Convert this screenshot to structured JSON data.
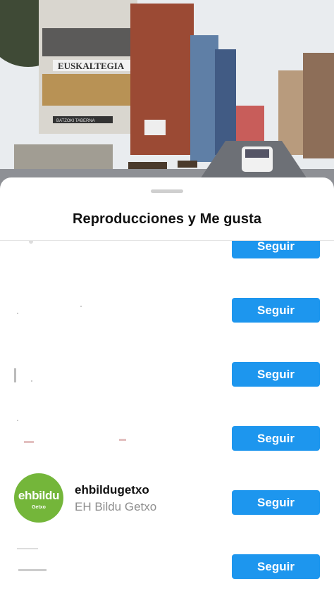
{
  "sheet": {
    "title": "Reproducciones y Me gusta"
  },
  "background": {
    "signs": [
      "EUSKALTEGIA",
      "BATZOKI TABERNA"
    ]
  },
  "list": {
    "items": [
      {
        "button_label": "Seguir",
        "username": "",
        "full_name": ""
      },
      {
        "button_label": "Seguir",
        "username": "",
        "full_name": ""
      },
      {
        "button_label": "Seguir",
        "username": "",
        "full_name": ""
      },
      {
        "button_label": "Seguir",
        "username": "",
        "full_name": ""
      },
      {
        "button_label": "Seguir",
        "username": "ehbildugetxo",
        "full_name": "EH Bildu Getxo",
        "avatar": {
          "logo_text": "ehbildu",
          "sub_text": "Getxo",
          "color": "#74b63a"
        }
      },
      {
        "button_label": "Seguir",
        "username": "",
        "full_name": ""
      }
    ]
  },
  "colors": {
    "accent": "#1d96ee"
  }
}
